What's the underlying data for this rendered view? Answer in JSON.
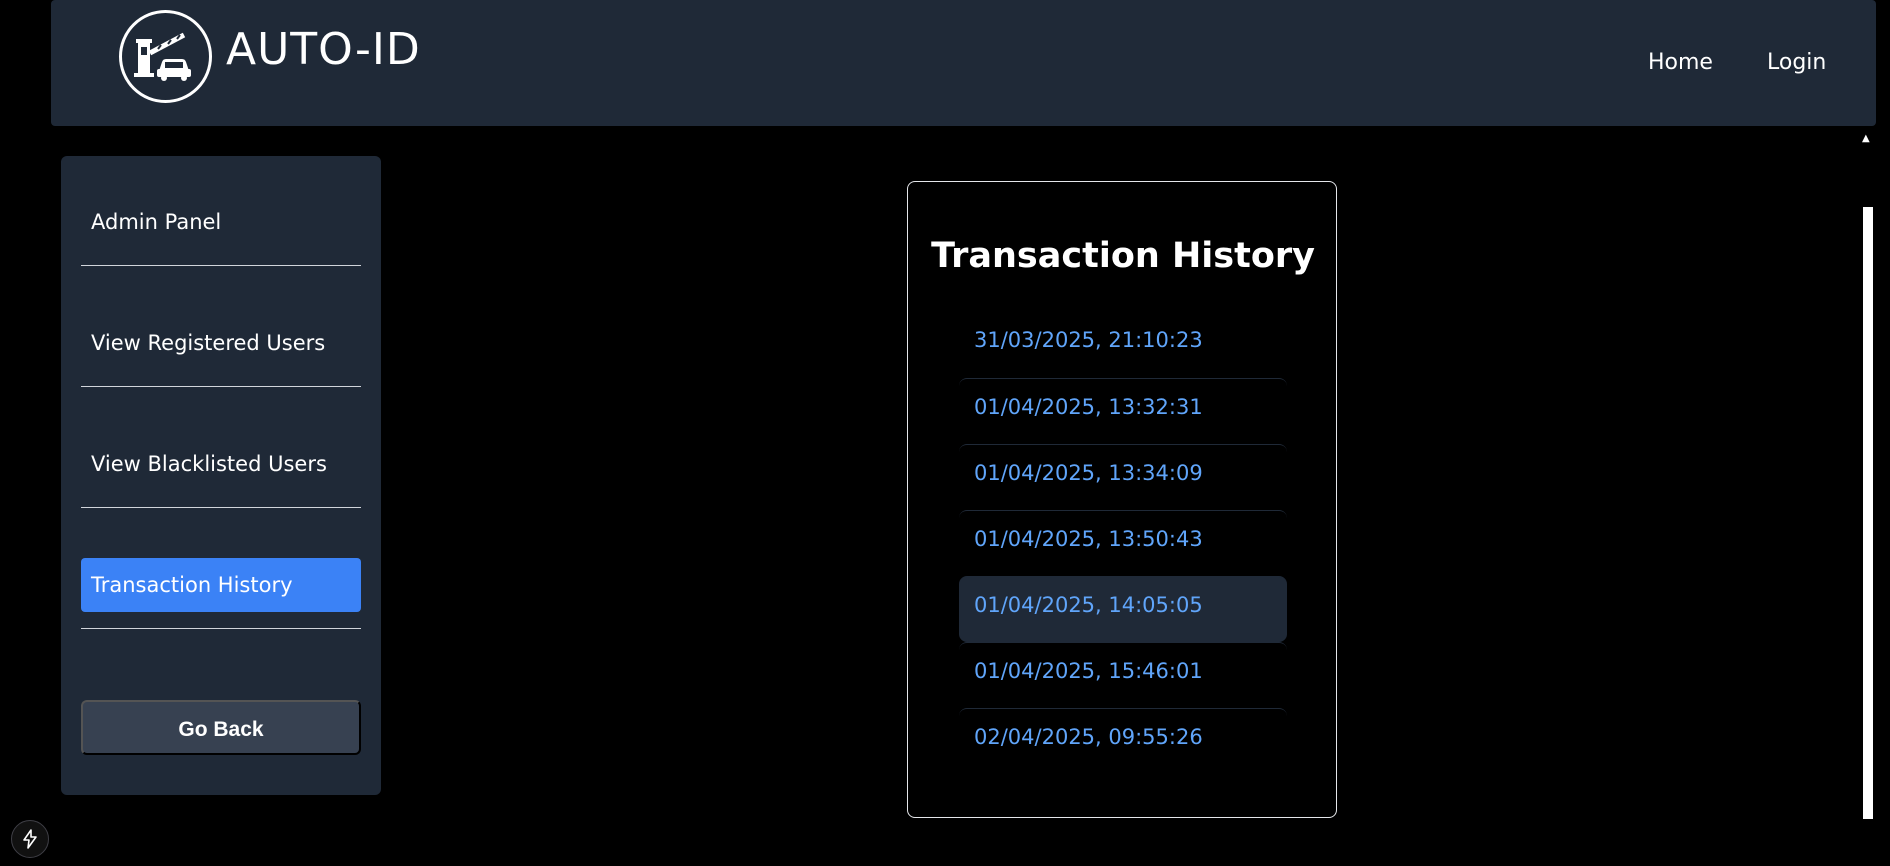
{
  "header": {
    "brand": "AUTO-ID",
    "logo_icon": "toll-booth-car-icon",
    "nav": {
      "home": "Home",
      "login": "Login"
    }
  },
  "sidebar": {
    "items": [
      {
        "label": "Admin Panel",
        "active": false
      },
      {
        "label": "View Registered Users",
        "active": false
      },
      {
        "label": "View Blacklisted Users",
        "active": false
      },
      {
        "label": "Transaction History",
        "active": true
      }
    ],
    "go_back": "Go Back"
  },
  "main": {
    "title": "Transaction History",
    "transactions": [
      "31/03/2025, 21:10:23",
      "01/04/2025, 13:32:31",
      "01/04/2025, 13:34:09",
      "01/04/2025, 13:50:43",
      "01/04/2025, 14:05:05",
      "01/04/2025, 15:46:01",
      "02/04/2025, 09:55:26"
    ],
    "highlighted_index": 4
  },
  "colors": {
    "page_bg": "#000000",
    "panel_bg": "#1f2937",
    "accent": "#3b82f6",
    "link": "#60a5fa",
    "button_bg": "#374151"
  },
  "dev_indicator_icon": "lightning-bolt-icon"
}
